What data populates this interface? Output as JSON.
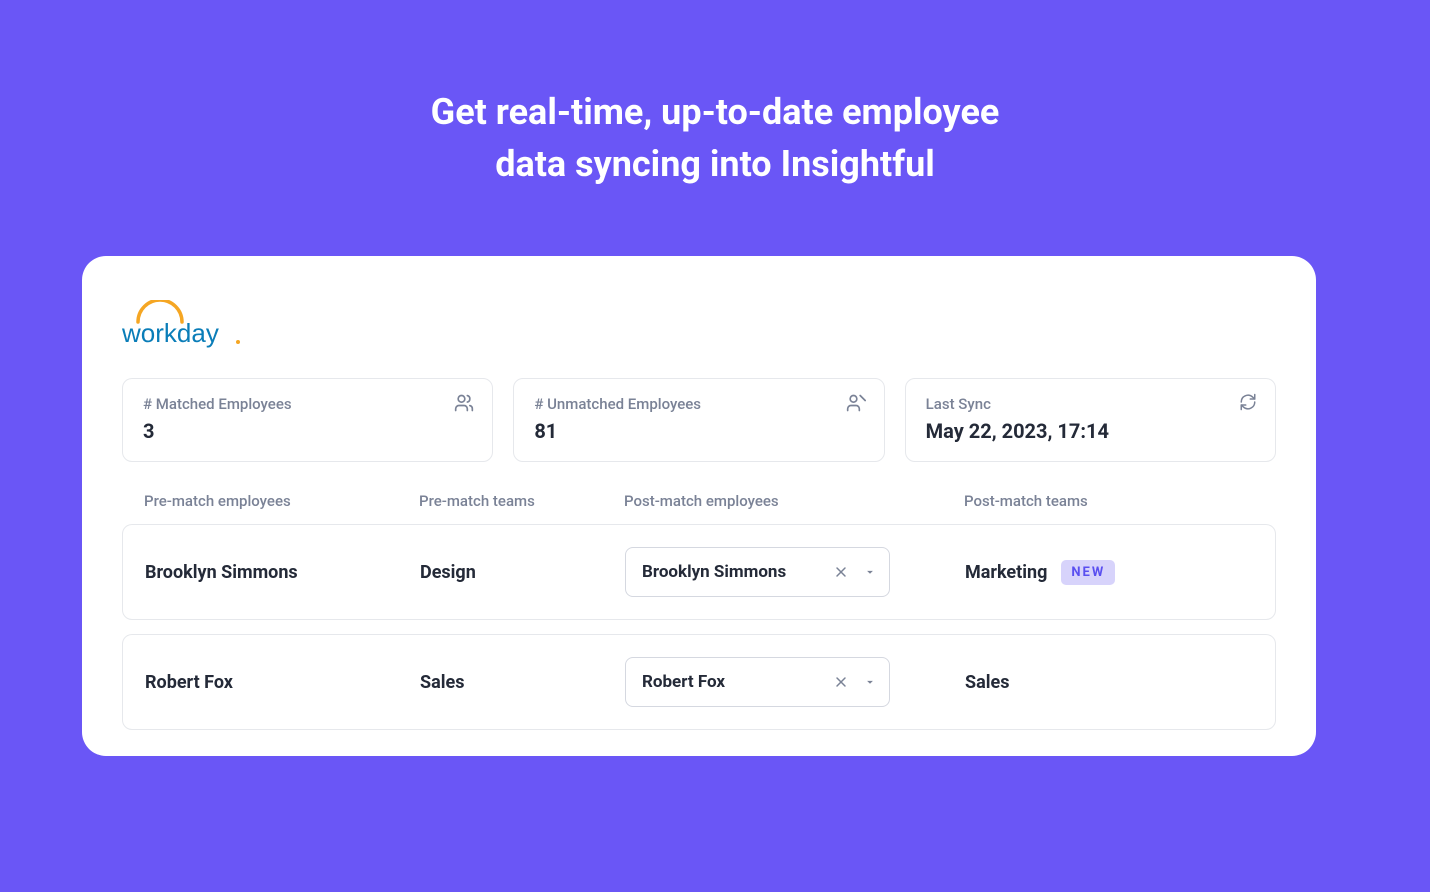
{
  "headline_line1": "Get real-time, up-to-date employee",
  "headline_line2": "data syncing into Insightful",
  "logo_text": "workday",
  "stats": {
    "matched": {
      "label": "# Matched Employees",
      "value": "3"
    },
    "unmatched": {
      "label": "# Unmatched Employees",
      "value": "81"
    },
    "last_sync": {
      "label": "Last Sync",
      "value": "May 22, 2023, 17:14"
    }
  },
  "columns": {
    "pre_emp": "Pre-match employees",
    "pre_team": "Pre-match teams",
    "post_emp": "Post-match employees",
    "post_team": "Post-match teams"
  },
  "rows": [
    {
      "pre_emp": "Brooklyn Simmons",
      "pre_team": "Design",
      "post_emp": "Brooklyn Simmons",
      "post_team": "Marketing",
      "post_team_new": true
    },
    {
      "pre_emp": "Robert Fox",
      "pre_team": "Sales",
      "post_emp": "Robert Fox",
      "post_team": "Sales",
      "post_team_new": false
    }
  ],
  "badge_new_label": "NEW"
}
